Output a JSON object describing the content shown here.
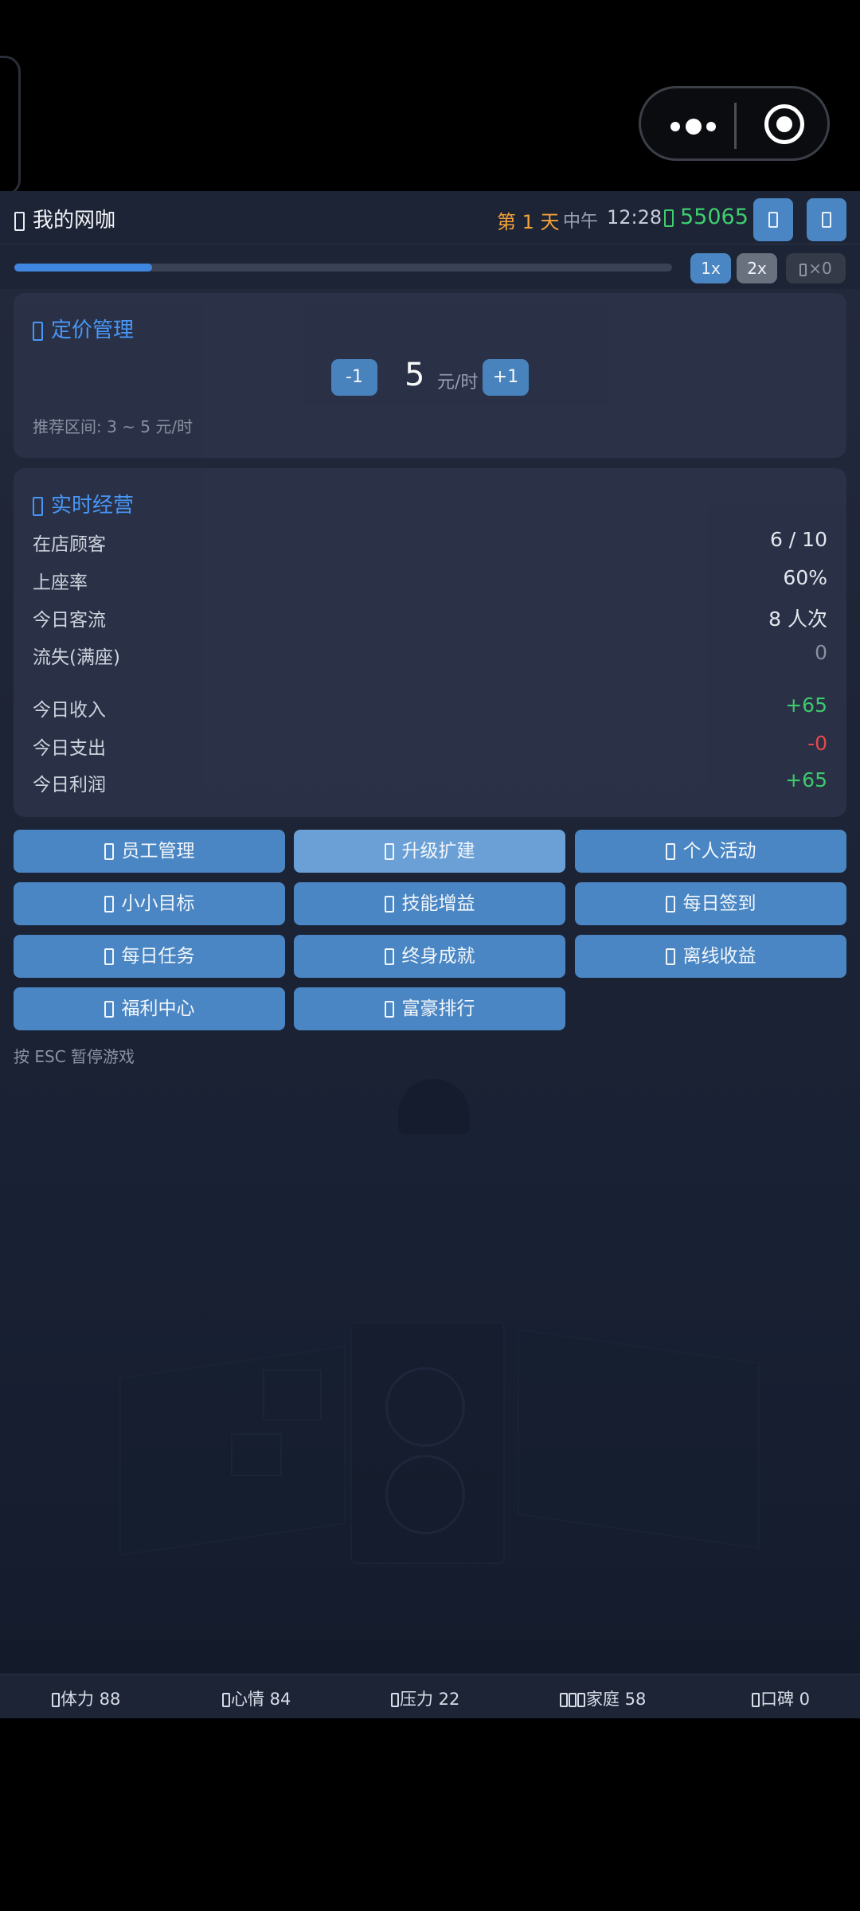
{
  "header": {
    "title": "我的网咖",
    "day": "第 1 天",
    "period": "中午",
    "clock": "12:28",
    "money": "55065"
  },
  "time_progress": 0.21,
  "speed": {
    "x1": "1x",
    "x2": "2x",
    "skip": "×0"
  },
  "pricing": {
    "title": "定价管理",
    "minus": "-1",
    "value": "5",
    "unit": "元/时",
    "plus": "+1",
    "hint": "推荐区间: 3 ~ 5 元/时"
  },
  "realtime": {
    "title": "实时经营",
    "rows": [
      {
        "label": "在店顾客",
        "value": "6 / 10",
        "color": "#eceff5"
      },
      {
        "label": "上座率",
        "value": "60%",
        "color": "#eceff5"
      },
      {
        "label": "今日客流",
        "value": "8 人次",
        "color": "#eceff5"
      },
      {
        "label": "流失(满座)",
        "value": "0",
        "color": "#8c94a6"
      },
      {
        "label": "今日收入",
        "value": "+65",
        "color": "#3ecf6e"
      },
      {
        "label": "今日支出",
        "value": "-0",
        "color": "#ef4a4a"
      },
      {
        "label": "今日利润",
        "value": "+65",
        "color": "#3ecf6e"
      }
    ]
  },
  "actions": [
    "员工管理",
    "升级扩建",
    "个人活动",
    "小小目标",
    "技能增益",
    "每日签到",
    "每日任务",
    "终身成就",
    "离线收益",
    "福利中心",
    "富豪排行"
  ],
  "esc_hint": "按 ESC 暂停游戏",
  "status": [
    {
      "label": "体力 88"
    },
    {
      "label": "心情 84"
    },
    {
      "label": "压力 22"
    },
    {
      "label": "家庭 58"
    },
    {
      "label": "口碑 0"
    }
  ],
  "colors": {
    "accent": "#4a86c3",
    "title_blue": "#4a9bff",
    "money_green": "#3ecf6e",
    "day_orange": "#f3a23a"
  }
}
